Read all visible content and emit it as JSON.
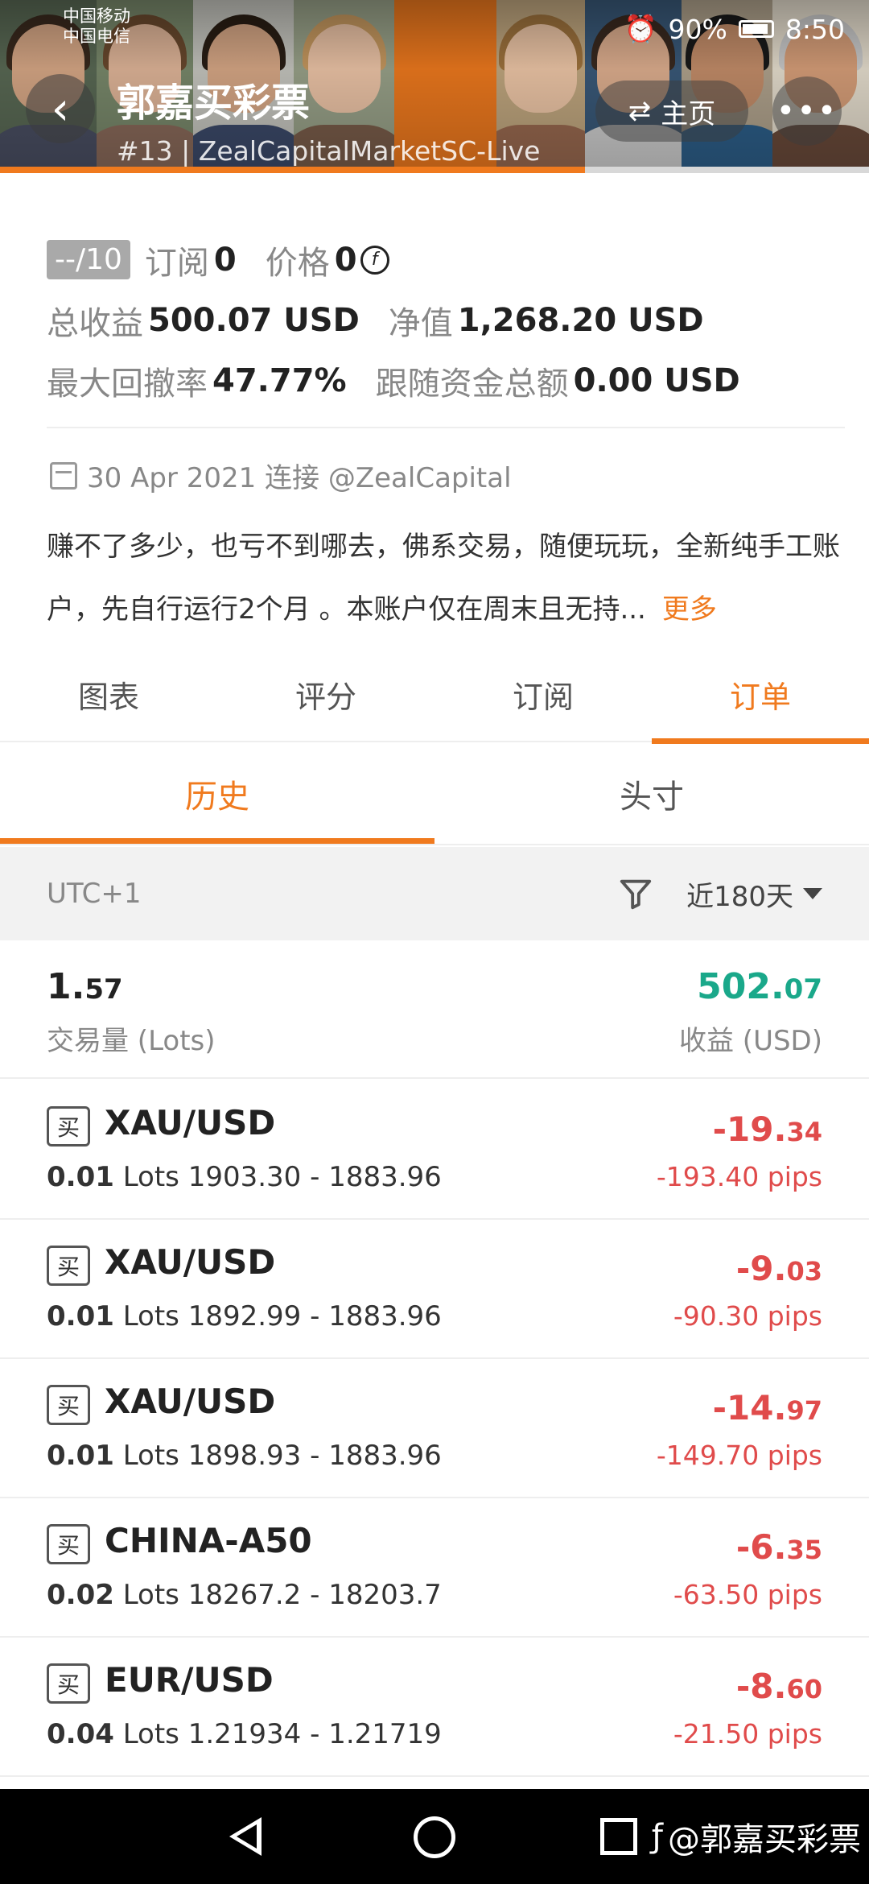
{
  "status_bar": {
    "carrier1": "中国移动",
    "carrier2": "中国电信",
    "battery": "90%",
    "time": "8:50"
  },
  "header": {
    "title": "郭嘉买彩票",
    "subtitle": "#13 | ZealCapitalMarketSC-Live",
    "home_label": "主页"
  },
  "stats": {
    "rating": "--/10",
    "subscribe_label": "订阅",
    "subscribe_value": "0",
    "price_label": "价格",
    "price_value": "0",
    "total_profit_label": "总收益",
    "total_profit_value": "500.07 USD",
    "net_label": "净值",
    "net_value": "1,268.20 USD",
    "drawdown_label": "最大回撤率",
    "drawdown_value": "47.77%",
    "follow_label": "跟随资金总额",
    "follow_value": "0.00 USD"
  },
  "info": {
    "date": "30 Apr 2021 连接 @ZealCapital",
    "description": "赚不了多少，也亏不到哪去，佛系交易，随便玩玩，全新纯手工账户，先自行运行2个月 。本账户仅在周末且无持...",
    "more": "更多"
  },
  "tabs": [
    "图表",
    "评分",
    "订阅",
    "订单"
  ],
  "subtabs": [
    "历史",
    "头寸"
  ],
  "filter": {
    "timezone": "UTC+1",
    "range": "近180天"
  },
  "summary": {
    "volume_int": "1.",
    "volume_dec": "57",
    "volume_label": "交易量 (Lots)",
    "profit_int": "502.",
    "profit_dec": "07",
    "profit_label": "收益 (USD)",
    "profit_color": "#1aa88a"
  },
  "orders": [
    {
      "side": "买",
      "symbol": "XAU/USD",
      "lots": "0.01",
      "unit": "Lots",
      "range": "1903.30 - 1883.96",
      "pnl_int": "-19.",
      "pnl_dec": "34",
      "pips": "-193.40 pips"
    },
    {
      "side": "买",
      "symbol": "XAU/USD",
      "lots": "0.01",
      "unit": "Lots",
      "range": "1892.99 - 1883.96",
      "pnl_int": "-9.",
      "pnl_dec": "03",
      "pips": "-90.30 pips"
    },
    {
      "side": "买",
      "symbol": "XAU/USD",
      "lots": "0.01",
      "unit": "Lots",
      "range": "1898.93 - 1883.96",
      "pnl_int": "-14.",
      "pnl_dec": "97",
      "pips": "-149.70 pips"
    },
    {
      "side": "买",
      "symbol": "CHINA-A50",
      "lots": "0.02",
      "unit": "Lots",
      "range": "18267.2 - 18203.7",
      "pnl_int": "-6.",
      "pnl_dec": "35",
      "pips": "-63.50 pips"
    },
    {
      "side": "买",
      "symbol": "EUR/USD",
      "lots": "0.04",
      "unit": "Lots",
      "range": "1.21934 - 1.21719",
      "pnl_int": "-8.",
      "pnl_dec": "60",
      "pips": "-21.50 pips"
    }
  ],
  "watermark": "@郭嘉买彩票",
  "colors": {
    "accent": "#f07a1e",
    "loss": "#e04b4b",
    "profit": "#1aa88a"
  }
}
